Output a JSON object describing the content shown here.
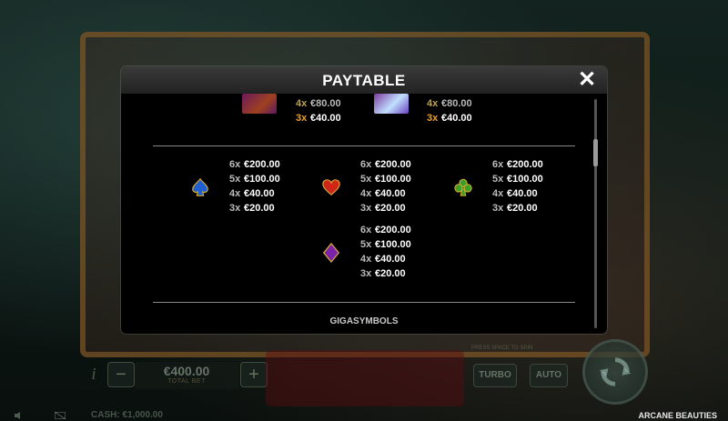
{
  "background": {
    "bet_value": "€400.00",
    "bet_label": "TOTAL BET",
    "info_label": "i",
    "minus_label": "−",
    "plus_label": "+",
    "turbo_label": "TURBO",
    "auto_label": "AUTO",
    "hint_text": "PRESS SPACE TO SPIN",
    "cash_text": "CASH: €1,000.00",
    "game_title": "ARCANE BEAUTIES"
  },
  "paytable": {
    "title": "PAYTABLE",
    "close_label": "✕",
    "top_symbols": [
      {
        "icon": "purple-beauty-symbol",
        "pays": [
          {
            "mult": "4x",
            "value": "€80.00"
          },
          {
            "mult": "3x",
            "value": "€40.00"
          }
        ]
      },
      {
        "icon": "blue-beauty-symbol",
        "pays": [
          {
            "mult": "4x",
            "value": "€80.00"
          },
          {
            "mult": "3x",
            "value": "€40.00"
          }
        ]
      }
    ],
    "low_symbols": [
      {
        "icon": "spade-icon",
        "color": "#2a6fd6",
        "pays": [
          {
            "mult": "6x",
            "value": "€200.00"
          },
          {
            "mult": "5x",
            "value": "€100.00"
          },
          {
            "mult": "4x",
            "value": "€40.00"
          },
          {
            "mult": "3x",
            "value": "€20.00"
          }
        ]
      },
      {
        "icon": "heart-icon",
        "color": "#d42a1a",
        "pays": [
          {
            "mult": "6x",
            "value": "€200.00"
          },
          {
            "mult": "5x",
            "value": "€100.00"
          },
          {
            "mult": "4x",
            "value": "€40.00"
          },
          {
            "mult": "3x",
            "value": "€20.00"
          }
        ]
      },
      {
        "icon": "club-icon",
        "color": "#4aa82a",
        "pays": [
          {
            "mult": "6x",
            "value": "€200.00"
          },
          {
            "mult": "5x",
            "value": "€100.00"
          },
          {
            "mult": "4x",
            "value": "€40.00"
          },
          {
            "mult": "3x",
            "value": "€20.00"
          }
        ]
      },
      {
        "icon": "diamond-icon",
        "color": "#8a2ab0",
        "pays": [
          {
            "mult": "6x",
            "value": "€200.00"
          },
          {
            "mult": "5x",
            "value": "€100.00"
          },
          {
            "mult": "4x",
            "value": "€40.00"
          },
          {
            "mult": "3x",
            "value": "€20.00"
          }
        ]
      }
    ],
    "next_section_title": "GIGASYMBOLS"
  }
}
